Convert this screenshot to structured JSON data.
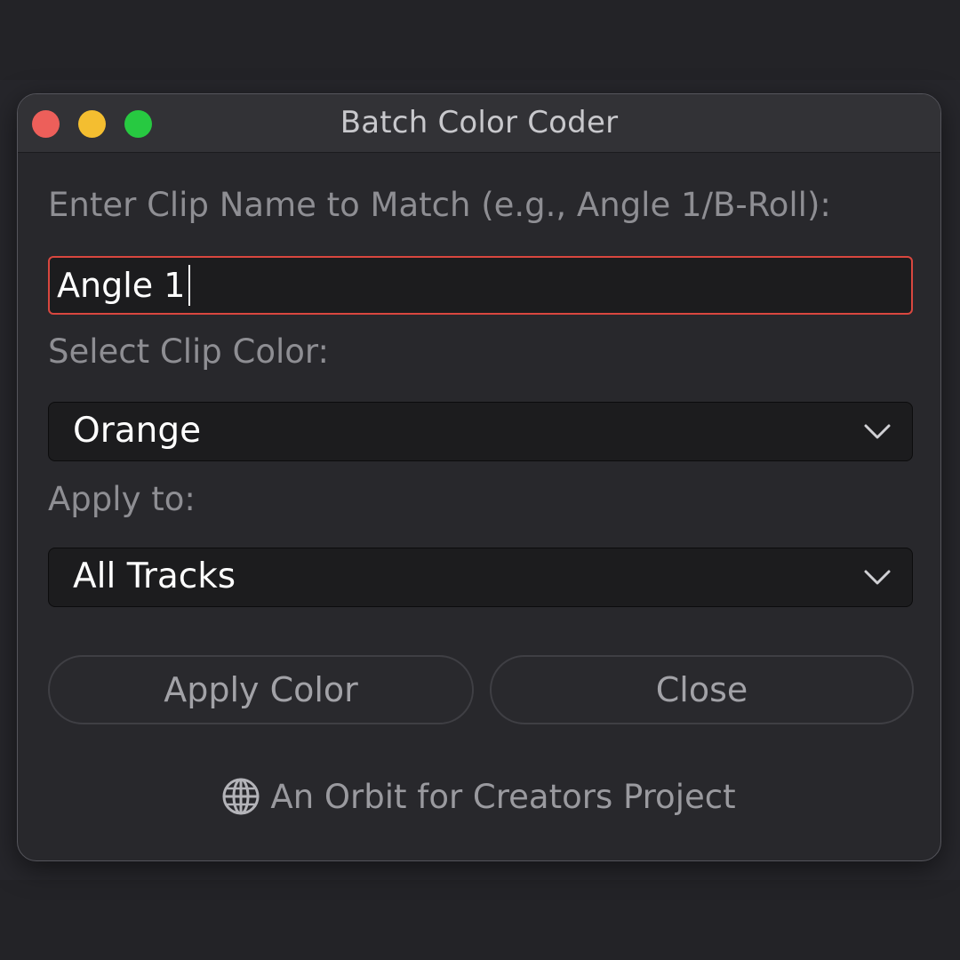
{
  "window": {
    "title": "Batch Color Coder"
  },
  "form": {
    "clip_name_label": "Enter Clip Name to Match (e.g., Angle 1/B-Roll):",
    "clip_name_value": "Angle 1",
    "color_label": "Select Clip Color:",
    "color_selected": "Orange",
    "apply_to_label": "Apply to:",
    "apply_to_selected": "All Tracks"
  },
  "buttons": {
    "apply_label": "Apply Color",
    "close_label": "Close"
  },
  "footer": {
    "icon": "globe-icon",
    "text": "An Orbit for Creators Project"
  },
  "colors": {
    "window_bg": "#28282c",
    "titlebar_bg": "#323236",
    "focus_border": "#d9473f",
    "traffic_close": "#ed5f5a",
    "traffic_minimize": "#f4be30",
    "traffic_maximize": "#27c941"
  }
}
